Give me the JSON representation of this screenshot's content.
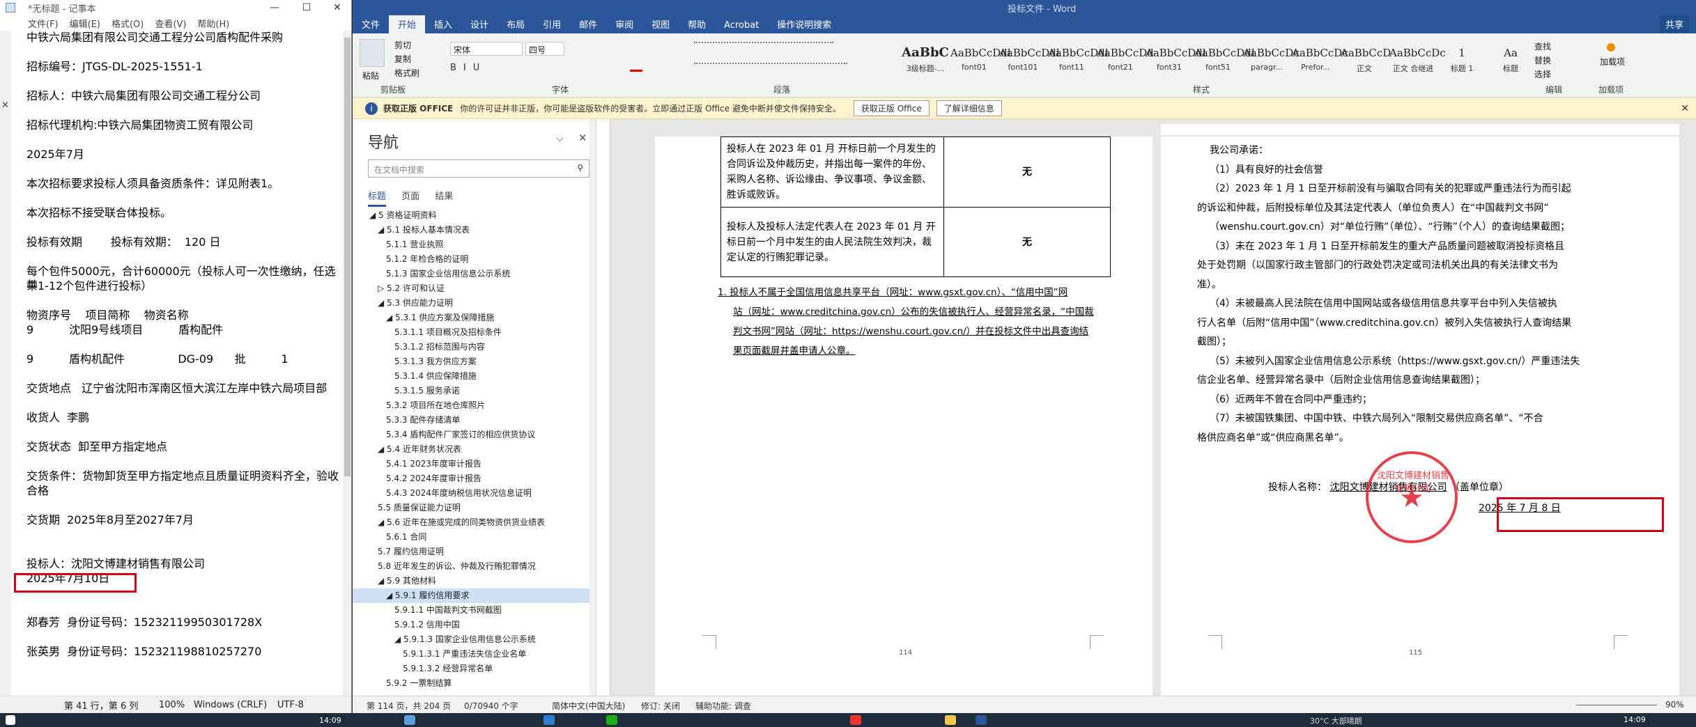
{
  "notepad": {
    "title": "*无标题 - 记事本",
    "menu": [
      "文件(F)",
      "编辑(E)",
      "格式(O)",
      "查看(V)",
      "帮助(H)"
    ],
    "lines": [
      "中铁六局集团有限公司交通工程分公司盾构配件采购",
      "",
      "招标编号：JTGS-DL-2025-1551-1",
      "",
      "招标人：中铁六局集团有限公司交通工程分公司",
      "",
      "招标代理机构:中铁六局集团物资工贸有限公司",
      "",
      "2025年7月",
      "",
      "本次招标要求投标人须具备资质条件：详见附表1。",
      "",
      "本次招标不接受联合体投标。",
      "",
      "投标有效期        投标有效期：  120 日",
      "",
      "每个包件5000元，合计60000元（投标人可一次性缴纳，任选其",
      "中1-12个包件进行投标）",
      "",
      "物资序号    项目简称    物资名称",
      "9          沈阳9号线项目          盾构配件",
      "",
      "9          盾构机配件               DG-09      批          1",
      "",
      "交货地点   辽宁省沈阳市浑南区恒大滨江左岸中铁六局项目部",
      "",
      "收货人  李鹏",
      "",
      "交货状态  卸至甲方指定地点",
      "",
      "交货条件：货物卸货至甲方指定地点且质量证明资料齐全，验收",
      "合格",
      "",
      "交货期  2025年8月至2027年7月",
      "",
      "",
      "投标人：沈阳文博建材销售有限公司",
      "2025年7月10日",
      "",
      "",
      "郑春芳  身份证号码：15232119950301728X",
      "",
      "张英男  身份证号码：152321198810257270"
    ],
    "status": {
      "pos": "第 41 行，第 6 列",
      "zoom": "100%",
      "eol": "Windows (CRLF)",
      "enc": "UTF-8"
    }
  },
  "word": {
    "title": "投标文件 - Word",
    "tabs": [
      "文件",
      "开始",
      "插入",
      "设计",
      "布局",
      "引用",
      "邮件",
      "审阅",
      "视图",
      "帮助",
      "Acrobat",
      "操作说明搜索"
    ],
    "share": "共享",
    "ribbon": {
      "paste": "粘贴",
      "clipboard": [
        "剪切",
        "复制",
        "格式刷"
      ],
      "clipboard_label": "剪贴板",
      "font_name": "宋体",
      "font_size": "四号",
      "font_label": "字体",
      "para_label": "段落",
      "styles_label": "样式",
      "edit_items": [
        "查找",
        "替换",
        "选择"
      ],
      "edit_label": "编辑",
      "addin": "加载项",
      "addin_label": "加载项",
      "styles": [
        {
          "preview": "AaBbC",
          "name": "3级标题-..."
        },
        {
          "preview": "AaBbCcDdl",
          "name": "font01"
        },
        {
          "preview": "AaBbCcDdl",
          "name": "font101"
        },
        {
          "preview": "AaBbCcDdl",
          "name": "font11"
        },
        {
          "preview": "AaBbCcDd",
          "name": "font21"
        },
        {
          "preview": "AaBbCcDdl",
          "name": "font31"
        },
        {
          "preview": "AaBbCcDdl",
          "name": "font51"
        },
        {
          "preview": "AaBbCcDc",
          "name": "paragr..."
        },
        {
          "preview": "AaBbCcDc",
          "name": "Prefor..."
        },
        {
          "preview": "AaBbCcD",
          "name": "正文"
        },
        {
          "preview": "AaBbCcDc",
          "name": "正文 合继进"
        },
        {
          "preview": "1",
          "name": "标题 1"
        },
        {
          "preview": "Aa",
          "name": "标题"
        }
      ]
    },
    "msgbar": {
      "title": "获取正版 OFFICE",
      "text": "你的许可证并非正版，你可能是盗版软件的受害者。立即通过正版 Office 避免中断并使文件保持安全。",
      "btn1": "获取正版 Office",
      "btn2": "了解详细信息"
    },
    "nav": {
      "title": "导航",
      "search_placeholder": "在文档中搜索",
      "tabs": [
        "标题",
        "页面",
        "结果"
      ],
      "items": [
        "◢ 5 资格证明资料",
        "◢ 5.1 投标人基本情况表",
        "5.1.1 营业执照",
        "5.1.2 年检合格的证明",
        "5.1.3 国家企业信用信息公示系统",
        "▷ 5.2 许可和认证",
        "◢ 5.3 供应能力证明",
        "◢ 5.3.1 供应方案及保障措施",
        "5.3.1.1 项目概况及招标条件",
        "5.3.1.2 招标范围与内容",
        "5.3.1.3 我方供应方案",
        "5.3.1.4 供应保障措施",
        "5.3.1.5 服务承诺",
        "5.3.2 项目所在地仓库照片",
        "5.3.3 配件存储清单",
        "5.3.4 盾构配件厂家签订的相应供货协议",
        "◢ 5.4 近年财务状况表",
        "5.4.1 2023年度审计报告",
        "5.4.2 2024年度审计报告",
        "5.4.3 2024年度纳税信用状况信息证明",
        "5.5 质量保证能力证明",
        "◢ 5.6 近年在施或完成的同类物资供货业绩表",
        "5.6.1 合同",
        "5.7 履约信用证明",
        "5.8 近年发生的诉讼、仲裁及行贿犯罪情况",
        "◢ 5.9 其他材料",
        "◢ 5.9.1 履约信用要求",
        "5.9.1.1 中国裁判文书网截图",
        "5.9.1.2 信用中国",
        "◢ 5.9.1.3 国家企业信用信息公示系统",
        "5.9.1.3.1 严重违法失信企业名单",
        "5.9.1.3.2 经营异常名单",
        "5.9.2 一票制结算"
      ]
    },
    "page114": {
      "row1_left": "投标人在 2023 年 01 月 开标日前一个月发生的合同诉讼及仲裁历史，并指出每一案件的年份、采购人名称、诉讼缘由、争议事项、争议金额、胜诉或败诉。",
      "row1_right": "无",
      "row2_left": "投标人及投标人法定代表人在 2023 年 01 月 开标日前一个月中发生的由人民法院生效判决，裁定认定的行贿犯罪记录。",
      "row2_right": "无",
      "note_lines": [
        "1.  投标人不属于全国信用信息共享平台（网址：www.gsxt.gov.cn）、“信用中国”网",
        "站（网址：www.creditchina.gov.cn）公布的失信被执行人、经营异常名录，“中国裁",
        "判文书网”网站（网址：https://wenshu.court.gov.cn/）并在投标文件中出具查询结",
        "果页面截屏并盖申请人公章。"
      ],
      "page_num": "114"
    },
    "page115": {
      "lines": [
        "我公司承诺：",
        "（1）具有良好的社会信誉",
        "（2）2023 年 1 月 1 日至开标前没有与骗取合同有关的犯罪或严重违法行为而引起",
        "的诉讼和仲裁，后附投标单位及其法定代表人（单位负责人）在“中国裁判文书网”",
        "（wenshu.court.gov.cn）对“单位行贿”（单位）、“行贿”（个人）的查询结果截图；",
        "（3）未在 2023 年 1 月 1 日至开标前发生的重大产品质量问题被取消投标资格且",
        "处于处罚期（以国家行政主管部门的行政处罚决定或司法机关出具的有关法律文书为",
        "准）。",
        "（4）未被最高人民法院在信用中国网站或各级信用信息共享平台中列入失信被执",
        "行人名单（后附“信用中国”（www.creditchina.gov.cn）被列入失信被执行人查询结果",
        "截图）；",
        "（5）未被列入国家企业信用信息公示系统（https://www.gsxt.gov.cn/）严重违法失",
        "信企业名单、经营异常名录中（后附企业信用信息查询结果截图）；",
        "（6）近两年不曾在合同中严重违约；",
        "（7）未被国铁集团、中国中铁、中铁六局列入“限制交易供应商名单”、“不合",
        "格供应商名单”或“供应商黑名单”。"
      ],
      "signer_label": "投标人名称：",
      "signer_name": "沈阳文博建材销售有限公司",
      "signer_suffix": "（盖单位章）",
      "date": "2025 年 7 月 8 日",
      "stamp_text": "沈阳文博建材销售有限公司",
      "page_num": "115"
    },
    "status": {
      "page": "第 114 页，共 204 页",
      "words": "0/70940 个字",
      "lang": "简体中文(中国大陆)",
      "track": "修订: 关闭",
      "access": "辅助功能: 调查",
      "zoom": "90%"
    }
  },
  "taskbar": {
    "time": "14:09",
    "weather": "30°C 大部晴朗"
  }
}
